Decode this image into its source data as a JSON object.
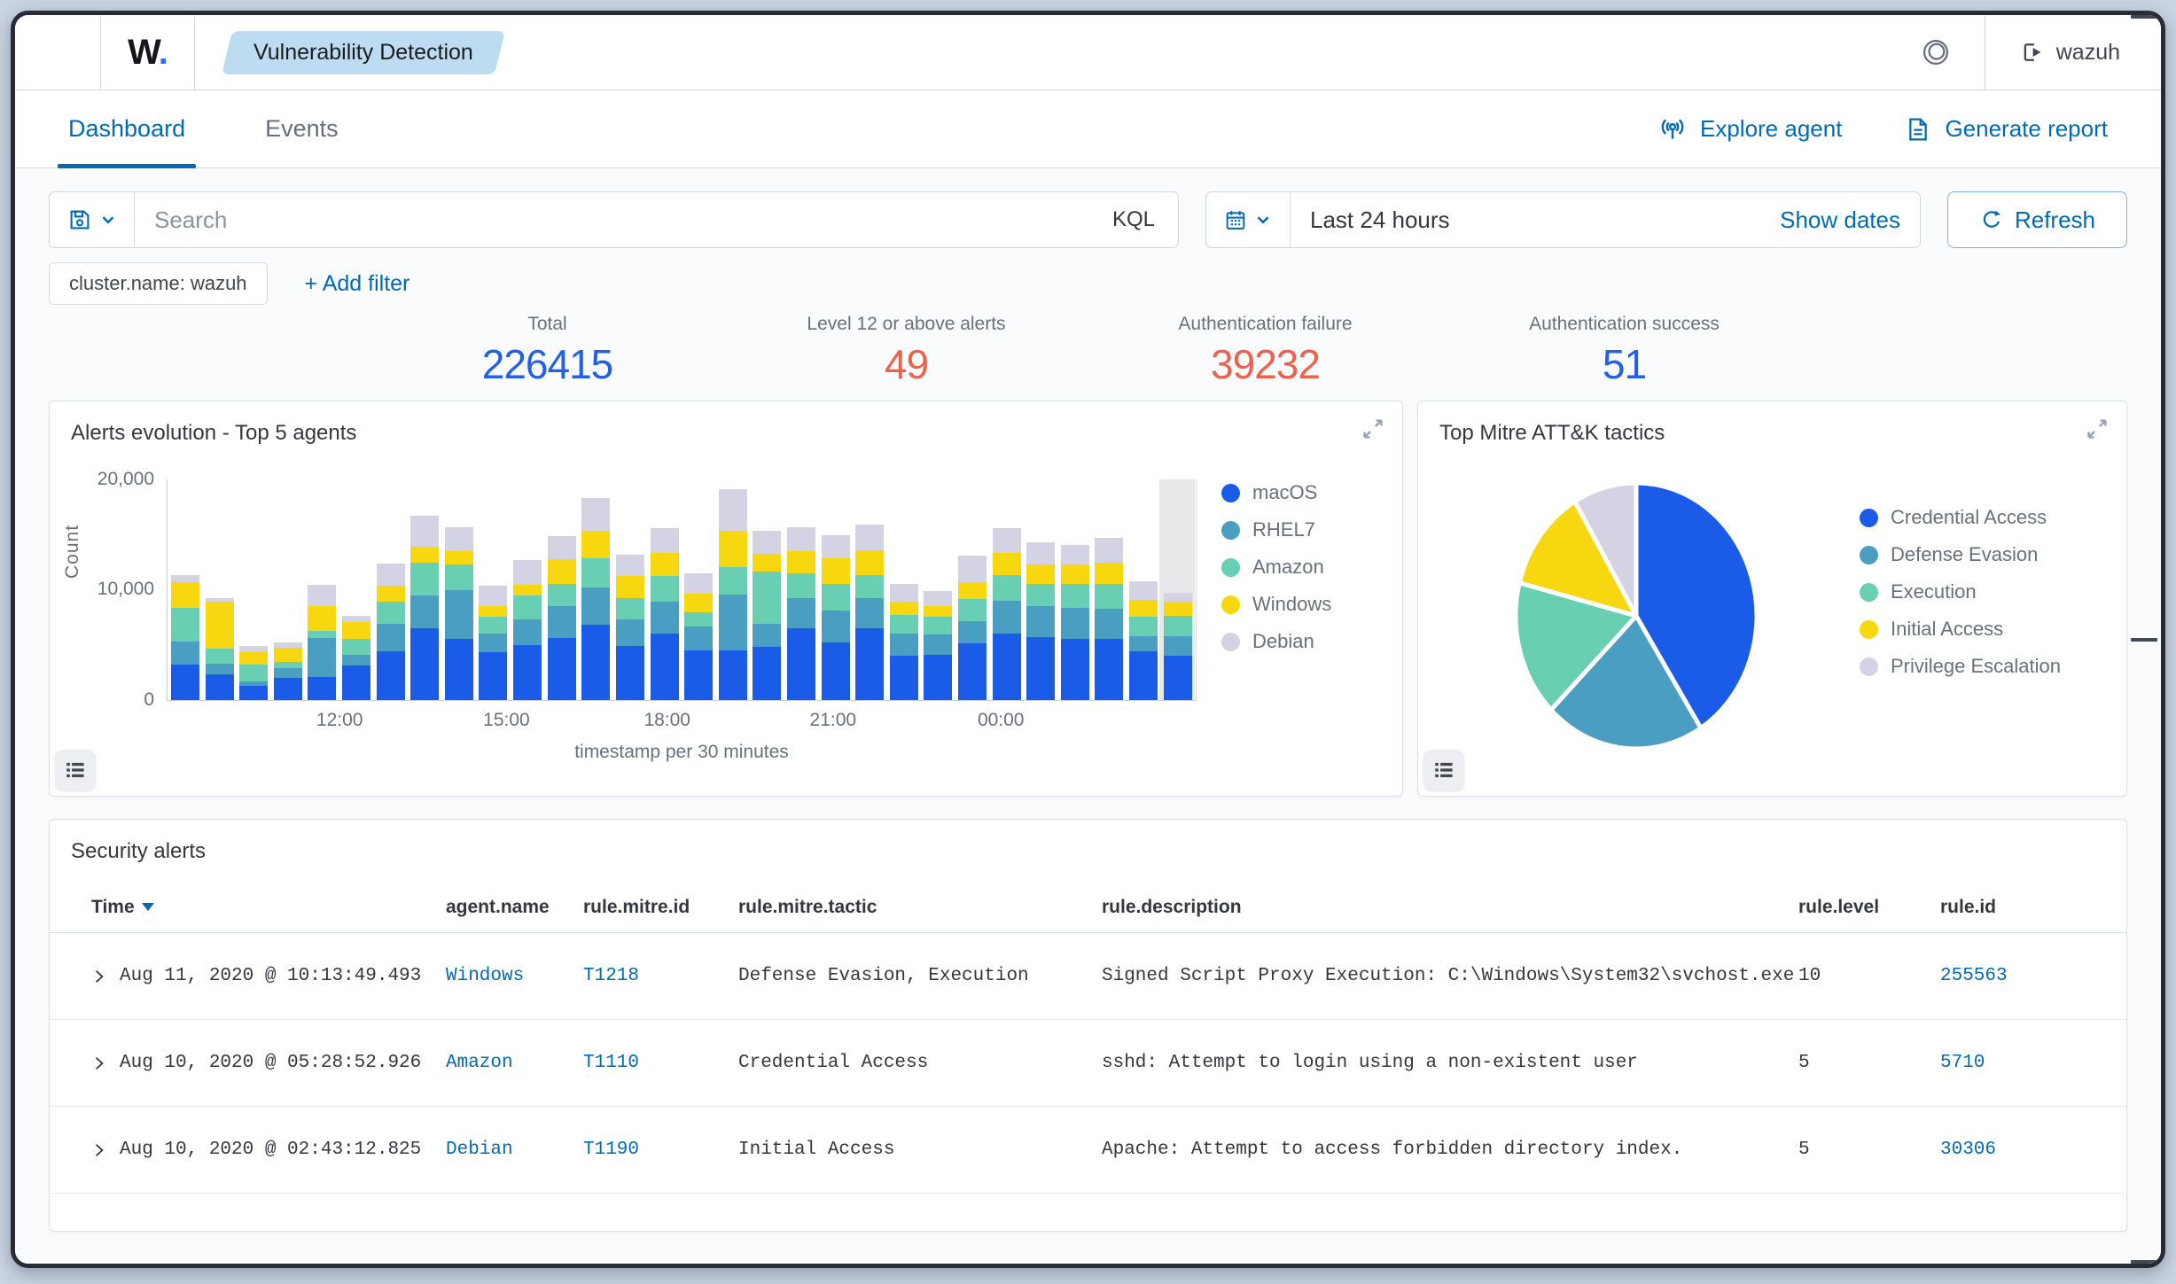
{
  "topbar": {
    "logo_main": "W",
    "logo_dot": ".",
    "breadcrumb": "Vulnerability Detection",
    "user_label": "wazuh"
  },
  "tabs": [
    {
      "label": "Dashboard",
      "active": true
    },
    {
      "label": "Events",
      "active": false
    }
  ],
  "header_actions": {
    "explore_agent": "Explore agent",
    "generate_report": "Generate report"
  },
  "search": {
    "placeholder": "Search",
    "language_label": "KQL",
    "time_range": "Last 24 hours",
    "show_dates_label": "Show dates",
    "refresh_label": "Refresh"
  },
  "filters": {
    "pill": "cluster.name: wazuh",
    "add_filter_label": "+ Add filter"
  },
  "stats": [
    {
      "label": "Total",
      "value": "226415",
      "color": "#2260e8"
    },
    {
      "label": "Level 12 or above alerts",
      "value": "49",
      "color": "#f0614b"
    },
    {
      "label": "Authentication failure",
      "value": "39232",
      "color": "#f0614b"
    },
    {
      "label": "Authentication success",
      "value": "51",
      "color": "#2260e8"
    }
  ],
  "panels": {
    "alerts_evolution_title": "Alerts evolution - Top 5 agents",
    "mitre_title": "Top Mitre ATT&K tactics",
    "security_alerts_title": "Security alerts"
  },
  "chart_data": [
    {
      "type": "bar",
      "stacked": true,
      "title": "Alerts evolution - Top 5 agents",
      "xlabel": "timestamp per 30 minutes",
      "ylabel": "Count",
      "ylim": [
        0,
        20000
      ],
      "y_ticks": [
        "0",
        "10,000",
        "20,000"
      ],
      "x_tick_labels": [
        "12:00",
        "15:00",
        "18:00",
        "21:00",
        "00:00"
      ],
      "x_tick_fractions": [
        0.168,
        0.33,
        0.486,
        0.647,
        0.81
      ],
      "legend_position": "right",
      "current_bucket_highlight": true,
      "series": [
        {
          "name": "macOS",
          "color": "#1a5ce8",
          "values": [
            3200,
            2300,
            1300,
            2000,
            2100,
            3100,
            4400,
            6500,
            5500,
            4300,
            5000,
            5600,
            6800,
            4900,
            6000,
            4500,
            4500,
            4800,
            6500,
            5200,
            6500,
            4000,
            4100,
            5100,
            6000,
            5700,
            5500,
            5500,
            4400,
            4000
          ]
        },
        {
          "name": "RHEL7",
          "color": "#4a9ec2",
          "values": [
            2100,
            1000,
            400,
            900,
            3500,
            1000,
            2500,
            2900,
            4400,
            1700,
            2300,
            2900,
            3400,
            2400,
            2900,
            2100,
            5000,
            2100,
            2700,
            2900,
            2700,
            2000,
            1800,
            2000,
            3000,
            2800,
            2800,
            2700,
            1400,
            1800
          ]
        },
        {
          "name": "Amazon",
          "color": "#69cfb2",
          "values": [
            3000,
            1300,
            1500,
            500,
            600,
            1400,
            2000,
            3000,
            2300,
            1500,
            2100,
            2000,
            2600,
            1900,
            2300,
            1300,
            2500,
            4700,
            2200,
            2400,
            2100,
            1700,
            1600,
            2000,
            2300,
            2000,
            2200,
            2300,
            1700,
            1800
          ]
        },
        {
          "name": "Windows",
          "color": "#f7d70f",
          "values": [
            2300,
            4300,
            1100,
            1300,
            2300,
            1500,
            1400,
            1400,
            1200,
            1000,
            1000,
            2200,
            2500,
            2000,
            2100,
            1700,
            3300,
            1600,
            2000,
            2300,
            2200,
            1200,
            1000,
            1500,
            2000,
            1700,
            1700,
            1900,
            1500,
            1200
          ]
        },
        {
          "name": "Debian",
          "color": "#d4d3e3",
          "values": [
            700,
            300,
            600,
            500,
            1900,
            600,
            2000,
            2800,
            2200,
            1800,
            2200,
            2100,
            2900,
            1900,
            2200,
            1800,
            3700,
            2100,
            2200,
            2100,
            2300,
            1600,
            1300,
            2400,
            2200,
            2000,
            1800,
            2200,
            1700,
            900
          ]
        }
      ]
    },
    {
      "type": "pie",
      "title": "Top Mitre ATT&K tactics",
      "labels": [
        "Credential Access",
        "Defense Evasion",
        "Execution",
        "Initial Access",
        "Privilege Escalation"
      ],
      "values_percent": [
        41,
        21.5,
        16.5,
        12.5,
        8.5
      ],
      "colors": [
        "#1a5ce8",
        "#4a9ec2",
        "#69cfb2",
        "#f7d70f",
        "#d4d3e3"
      ],
      "legend_position": "right"
    }
  ],
  "table": {
    "headers": [
      "Time",
      "agent.name",
      "rule.mitre.id",
      "rule.mitre.tactic",
      "rule.description",
      "rule.level",
      "rule.id"
    ],
    "sorted_column": "Time",
    "rows": [
      {
        "time": "Aug 11, 2020 @ 10:13:49.493",
        "agent": "Windows",
        "mitre_id": "T1218",
        "tactic": "Defense Evasion, Execution",
        "description": "Signed Script Proxy Execution: C:\\Windows\\System32\\svchost.exe",
        "level": "10",
        "rule_id": "255563"
      },
      {
        "time": "Aug 10, 2020 @ 05:28:52.926",
        "agent": "Amazon",
        "mitre_id": "T1110",
        "tactic": "Credential Access",
        "description": "sshd: Attempt to login using a non-existent user",
        "level": "5",
        "rule_id": "5710"
      },
      {
        "time": "Aug 10, 2020 @ 02:43:12.825",
        "agent": "Debian",
        "mitre_id": "T1190",
        "tactic": "Initial Access",
        "description": "Apache: Attempt to access forbidden directory index.",
        "level": "5",
        "rule_id": "30306"
      }
    ]
  }
}
